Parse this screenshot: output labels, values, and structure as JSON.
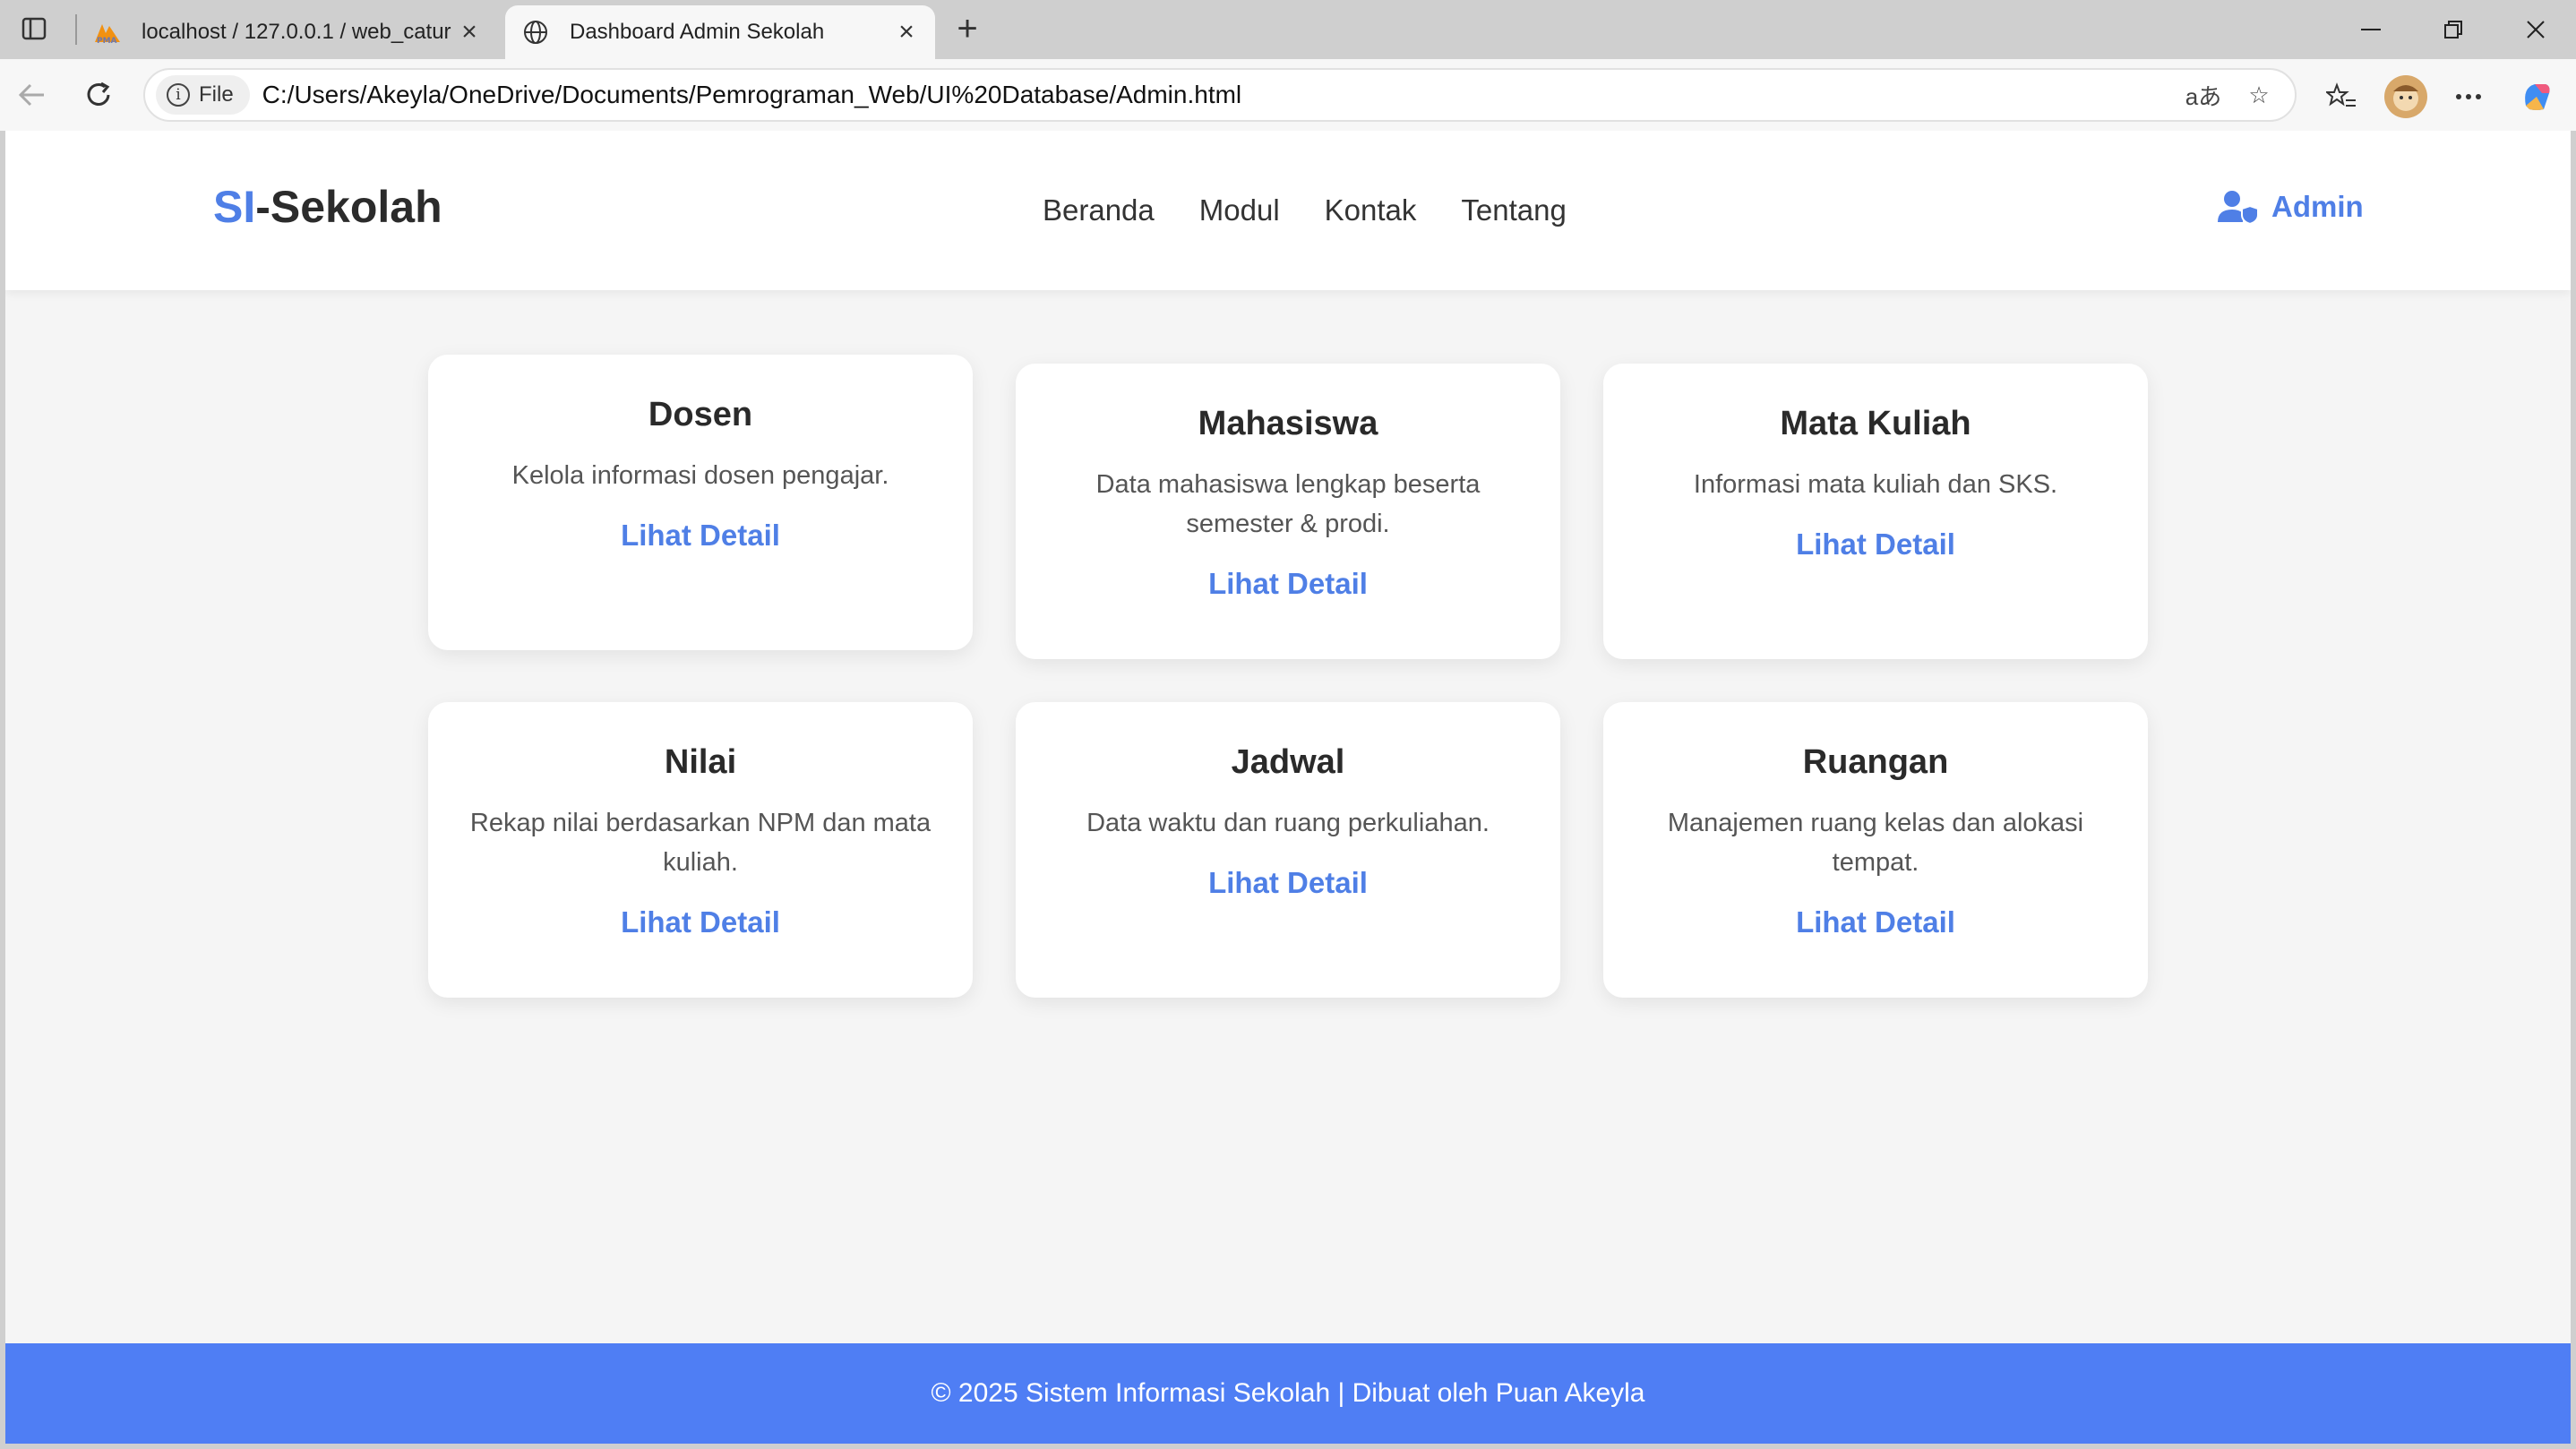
{
  "browser": {
    "tabs": [
      {
        "title": "localhost / 127.0.0.1 / web_catur |",
        "active": false,
        "icon": "phpmyadmin-icon"
      },
      {
        "title": "Dashboard Admin Sekolah",
        "active": true,
        "icon": "globe-icon"
      }
    ],
    "address": {
      "scheme_label": "File",
      "url": "C:/Users/Akeyla/OneDrive/Documents/Pemrograman_Web/UI%20Database/Admin.html"
    },
    "read_aloud_glyph": "aあ"
  },
  "site": {
    "logo_accent": "SI",
    "logo_rest": "-Sekolah",
    "nav": [
      "Beranda",
      "Modul",
      "Kontak",
      "Tentang"
    ],
    "user_label": "Admin",
    "accent_color": "#4f7fe6"
  },
  "cards": [
    {
      "title": "Dosen",
      "desc": "Kelola informasi dosen pengajar.",
      "link": "Lihat Detail"
    },
    {
      "title": "Mahasiswa",
      "desc": "Data mahasiswa lengkap beserta semester & prodi.",
      "link": "Lihat Detail"
    },
    {
      "title": "Mata Kuliah",
      "desc": "Informasi mata kuliah dan SKS.",
      "link": "Lihat Detail"
    },
    {
      "title": "Nilai",
      "desc": "Rekap nilai berdasarkan NPM dan mata kuliah.",
      "link": "Lihat Detail"
    },
    {
      "title": "Jadwal",
      "desc": "Data waktu dan ruang perkuliahan.",
      "link": "Lihat Detail"
    },
    {
      "title": "Ruangan",
      "desc": "Manajemen ruang kelas dan alokasi tempat.",
      "link": "Lihat Detail"
    }
  ],
  "footer": {
    "text": "© 2025 Sistem Informasi Sekolah | Dibuat oleh Puan Akeyla",
    "color": "#4f7ef4"
  }
}
